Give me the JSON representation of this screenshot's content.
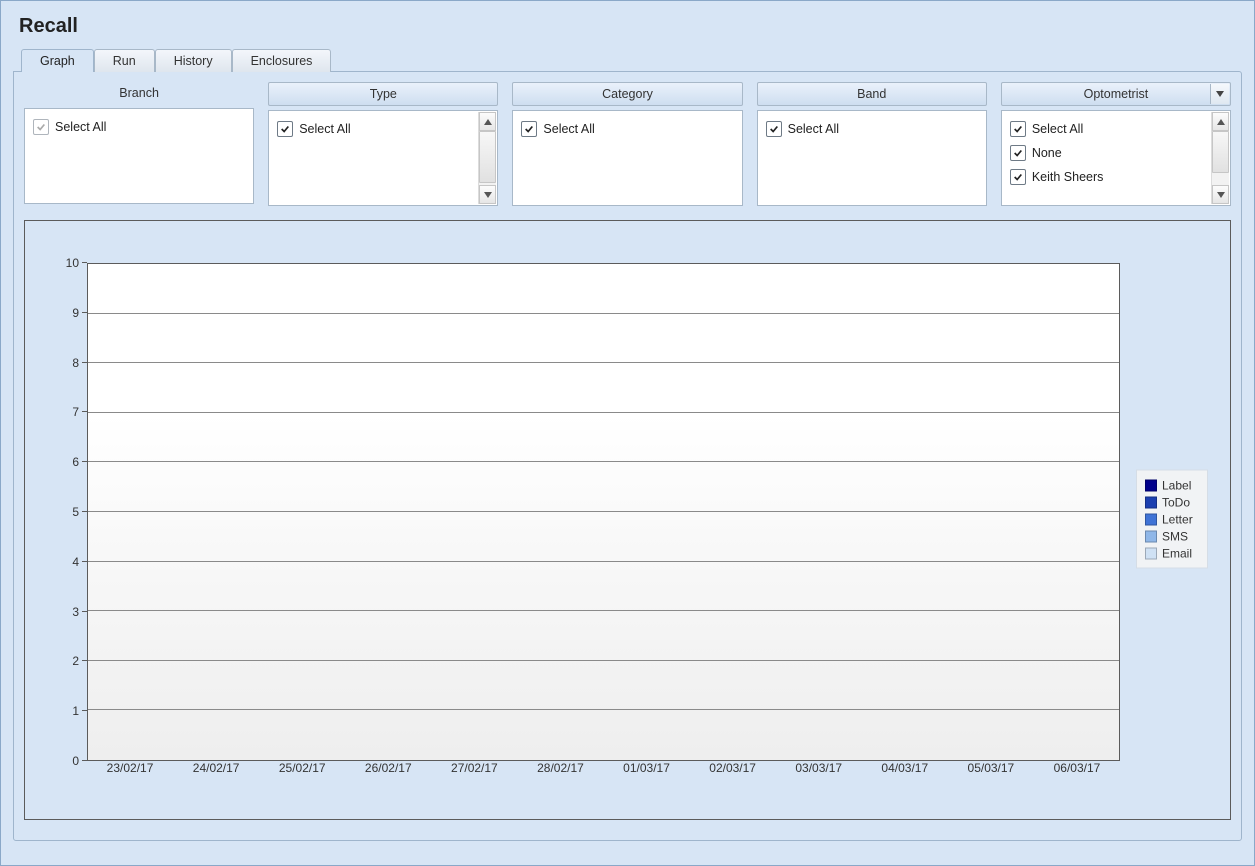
{
  "page_title": "Recall",
  "tabs": [
    "Graph",
    "Run",
    "History",
    "Enclosures"
  ],
  "active_tab": 0,
  "filters": {
    "branch": {
      "header": "Branch",
      "header_style": "plain",
      "scroll": false,
      "items": [
        {
          "label": "Select All",
          "checked": true,
          "disabled": true
        }
      ]
    },
    "type": {
      "header": "Type",
      "header_style": "panel",
      "scroll": true,
      "items": [
        {
          "label": "Select All",
          "checked": true,
          "disabled": false
        }
      ]
    },
    "category": {
      "header": "Category",
      "header_style": "panel",
      "scroll": false,
      "items": [
        {
          "label": "Select All",
          "checked": true,
          "disabled": false
        }
      ]
    },
    "band": {
      "header": "Band",
      "header_style": "panel",
      "scroll": false,
      "items": [
        {
          "label": "Select All",
          "checked": true,
          "disabled": false
        }
      ]
    },
    "optometrist": {
      "header": "Optometrist",
      "header_style": "panel-dd",
      "scroll": true,
      "items": [
        {
          "label": "Select All",
          "checked": true,
          "disabled": false
        },
        {
          "label": "None",
          "checked": true,
          "disabled": false
        },
        {
          "label": "Keith Sheers",
          "checked": true,
          "disabled": false
        }
      ]
    }
  },
  "chart_data": {
    "type": "bar",
    "categories": [
      "23/02/17",
      "24/02/17",
      "25/02/17",
      "26/02/17",
      "27/02/17",
      "28/02/17",
      "01/03/17",
      "02/03/17",
      "03/03/17",
      "04/03/17",
      "05/03/17",
      "06/03/17"
    ],
    "series": [
      {
        "name": "Label",
        "color": "#00008b",
        "values": [
          0,
          0,
          0,
          0,
          0,
          0,
          0,
          0,
          0,
          0,
          0,
          0
        ]
      },
      {
        "name": "ToDo",
        "color": "#1b3fb0",
        "values": [
          0,
          0,
          0,
          0,
          0,
          0,
          0,
          0,
          0,
          0,
          0,
          0
        ]
      },
      {
        "name": "Letter",
        "color": "#3f73d6",
        "values": [
          0,
          0,
          0,
          0,
          0,
          0,
          0,
          0,
          0,
          0,
          0,
          0
        ]
      },
      {
        "name": "SMS",
        "color": "#8fb7e8",
        "values": [
          0,
          0,
          0,
          0,
          0,
          0,
          0,
          0,
          0,
          0,
          0,
          0
        ]
      },
      {
        "name": "Email",
        "color": "#cfe1f4",
        "values": [
          0,
          0,
          0,
          0,
          0,
          0,
          0,
          0,
          0,
          0,
          0,
          0
        ]
      }
    ],
    "ylim": [
      0,
      10
    ],
    "y_ticks": [
      0,
      1,
      2,
      3,
      4,
      5,
      6,
      7,
      8,
      9,
      10
    ],
    "title": "",
    "xlabel": "",
    "ylabel": ""
  }
}
